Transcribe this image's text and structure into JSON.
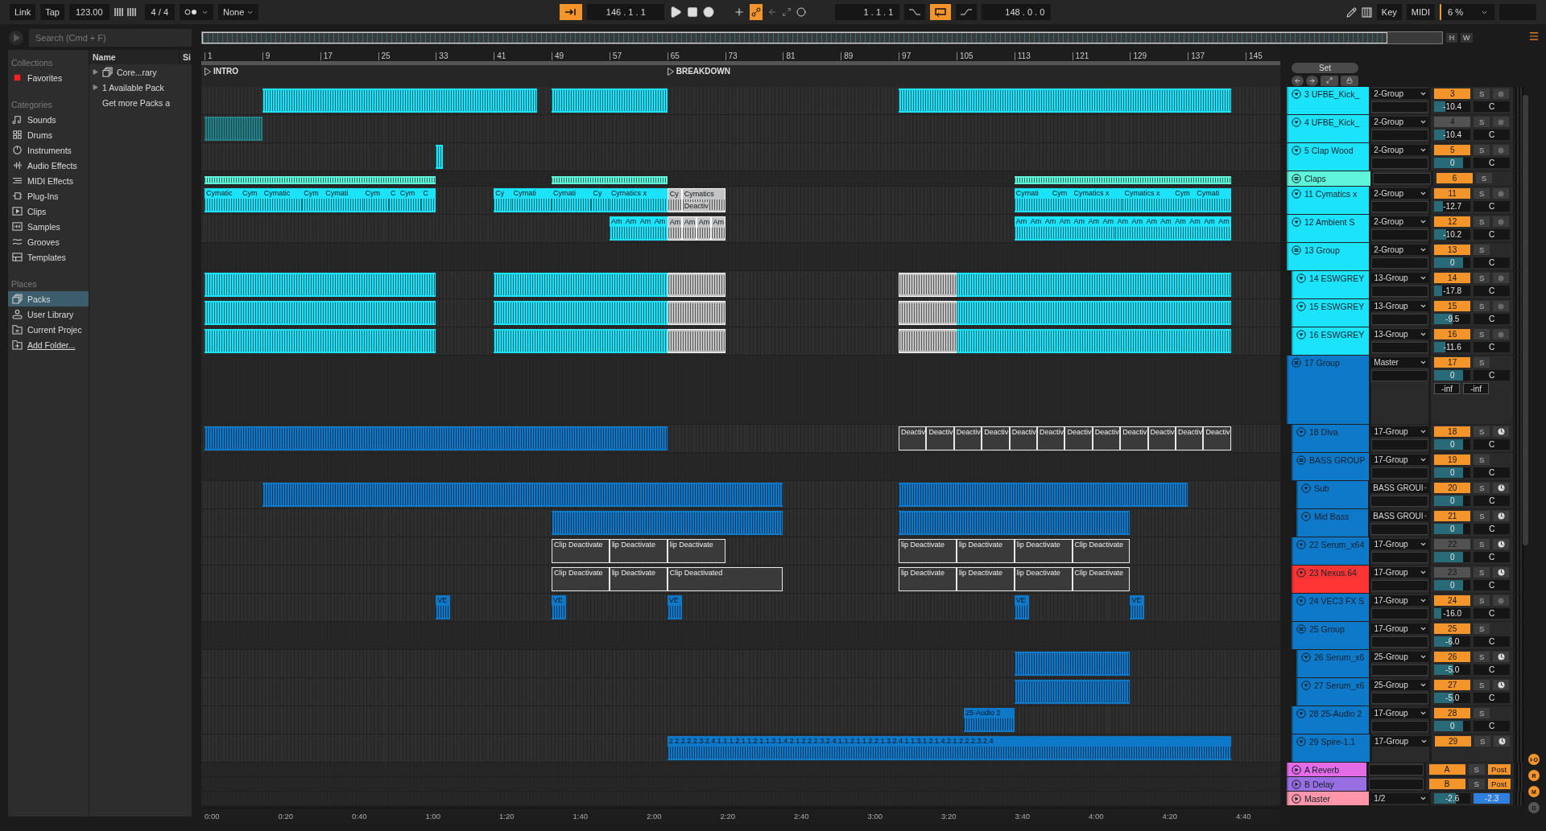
{
  "transport": {
    "link": "Link",
    "tap": "Tap",
    "tempo": "123.00",
    "signature": "4 / 4",
    "quantize": "None",
    "position": "146 .  1 .  1",
    "loop_start": "1 .  1 .  1",
    "loop_length": "148 .  0 .  0",
    "key": "Key",
    "midi": "MIDI",
    "cpu": "6 %",
    "follow": true,
    "loop": true
  },
  "browser": {
    "search": {
      "placeholder": "Search (Cmd + F)"
    },
    "sections": [
      {
        "title": "Collections",
        "items": [
          {
            "label": "Favorites",
            "color": "#ff2020",
            "selected": false
          }
        ]
      },
      {
        "title": "Categories",
        "items": [
          {
            "label": "Sounds",
            "selected": false
          },
          {
            "label": "Drums",
            "selected": false
          },
          {
            "label": "Instruments",
            "selected": false
          },
          {
            "label": "Audio Effects",
            "selected": false
          },
          {
            "label": "MIDI Effects",
            "selected": false
          },
          {
            "label": "Plug-Ins",
            "selected": false
          },
          {
            "label": "Clips",
            "selected": false
          },
          {
            "label": "Samples",
            "selected": false
          },
          {
            "label": "Grooves",
            "selected": false
          },
          {
            "label": "Templates",
            "selected": false
          }
        ]
      },
      {
        "title": "Places",
        "items": [
          {
            "label": "Packs",
            "selected": true
          },
          {
            "label": "User Library",
            "selected": false
          },
          {
            "label": "Current Projec",
            "selected": false
          },
          {
            "label": "Add Folder...",
            "selected": false
          }
        ]
      }
    ],
    "columns": [
      "Name",
      "Si"
    ],
    "files": [
      {
        "label": "Core...rary",
        "kind": "pack"
      },
      {
        "label": "1 Available Pack",
        "kind": "folder"
      },
      {
        "label": "Get more Packs a",
        "kind": "link"
      }
    ]
  },
  "set_button": "Set",
  "overview_buttons": [
    "H",
    "W"
  ],
  "ruler": [
    "1",
    "9",
    "17",
    "25",
    "33",
    "41",
    "49",
    "57",
    "65",
    "73",
    "81",
    "89",
    "97",
    "105",
    "113",
    "121",
    "129",
    "137",
    "145"
  ],
  "locators": [
    "INTRO",
    "BREAKDOWN"
  ],
  "tracks": [
    {
      "name": "3 UFBE_Kick_",
      "kind": "audio",
      "color": "#1be3fb",
      "output": "2-Group",
      "number": "3",
      "active": true,
      "volume": "-10.4",
      "level": 0.3,
      "pan": "C",
      "solo": "S",
      "clips": [
        {
          "selected": false,
          "deactivated": false
        },
        {
          "selected": false,
          "deactivated": false
        },
        {
          "selected": false,
          "deactivated": false
        }
      ]
    },
    {
      "name": "4 UFBE_Kick_",
      "kind": "audio",
      "color": "#1be3fb",
      "output": "2-Group",
      "number": "4",
      "active": false,
      "volume": "-10.4",
      "level": 0.3,
      "pan": "C",
      "solo": "S",
      "clips": [
        {
          "selected": false,
          "deactivated": false
        }
      ]
    },
    {
      "name": "5 Clap Wood",
      "kind": "audio",
      "color": "#1be3fb",
      "output": "2-Group",
      "number": "5",
      "active": true,
      "volume": "0",
      "level": 0.8,
      "pan": "C",
      "solo": "S",
      "clips": [
        {
          "selected": false,
          "deactivated": false
        }
      ]
    },
    {
      "name": "Claps",
      "kind": "group",
      "color": "#5ef5da",
      "number": "6",
      "active": true,
      "solo": "S",
      "clips": [
        {
          "selected": false,
          "deactivated": false
        },
        {
          "selected": false,
          "deactivated": false
        },
        {
          "selected": false,
          "deactivated": false
        }
      ]
    },
    {
      "name": "11 Cymatics x",
      "kind": "audio",
      "color": "#1be3fb",
      "output": "2-Group",
      "number": "11",
      "active": true,
      "volume": "-12.7",
      "level": 0.25,
      "pan": "C",
      "solo": "S",
      "clips": [
        {
          "label": "Cymatic",
          "selected": false,
          "deactivated": false
        },
        {
          "label": "Cym",
          "selected": false,
          "deactivated": false
        },
        {
          "label": "Cymatic",
          "selected": false,
          "deactivated": false
        },
        {
          "label": "Cym",
          "selected": false,
          "deactivated": false
        },
        {
          "label": "Cymati",
          "selected": false,
          "deactivated": false
        },
        {
          "label": "Cym",
          "selected": false,
          "deactivated": false
        },
        {
          "label": "C",
          "selected": false,
          "deactivated": false
        },
        {
          "label": "Cym",
          "selected": false,
          "deactivated": false
        },
        {
          "label": "C",
          "selected": false,
          "deactivated": false
        },
        {
          "label": "Cy",
          "selected": false,
          "deactivated": false
        },
        {
          "label": "Cymati",
          "selected": false,
          "deactivated": false
        },
        {
          "label": "Cymati",
          "selected": false,
          "deactivated": false
        },
        {
          "label": "Cy",
          "selected": false,
          "deactivated": false
        },
        {
          "label": "Cymatics x",
          "selected": false,
          "deactivated": false
        },
        {
          "label": "Cy",
          "selected": true,
          "deactivated": false
        },
        {
          "label": "Cymatics",
          "sublabel": "Deactiv",
          "selected": true,
          "deactivated": false
        },
        {
          "label": "Cymati",
          "selected": false,
          "deactivated": false
        },
        {
          "label": "Cym",
          "selected": false,
          "deactivated": false
        },
        {
          "label": "Cymatics x",
          "selected": false,
          "deactivated": false
        },
        {
          "label": "Cymatics x",
          "selected": false,
          "deactivated": false
        },
        {
          "label": "Cym",
          "selected": false,
          "deactivated": false
        },
        {
          "label": "Cymati",
          "selected": false,
          "deactivated": false
        }
      ]
    },
    {
      "name": "12 Ambient S",
      "kind": "audio",
      "color": "#1be3fb",
      "output": "2-Group",
      "number": "12",
      "active": true,
      "volume": "-10.2",
      "level": 0.32,
      "pan": "C",
      "solo": "S",
      "clips": [
        {
          "label": "Am",
          "selected": false,
          "deactivated": false
        },
        {
          "label": "Am",
          "selected": false,
          "deactivated": false
        },
        {
          "label": "Am",
          "selected": false,
          "deactivated": false
        },
        {
          "label": "Am",
          "selected": false,
          "deactivated": false
        },
        {
          "label": "Am",
          "selected": true,
          "deactivated": false
        },
        {
          "label": "Am",
          "selected": true,
          "deactivated": false
        },
        {
          "label": "Am",
          "selected": true,
          "deactivated": false
        },
        {
          "label": "Am",
          "selected": true,
          "deactivated": false
        },
        {
          "label": "Am",
          "selected": false,
          "deactivated": false
        },
        {
          "label": "Am",
          "selected": false,
          "deactivated": false
        },
        {
          "label": "Am",
          "selected": false,
          "deactivated": false
        },
        {
          "label": "Am",
          "selected": false,
          "deactivated": false
        },
        {
          "label": "Am",
          "selected": false,
          "deactivated": false
        },
        {
          "label": "Am",
          "selected": false,
          "deactivated": false
        },
        {
          "label": "Am",
          "selected": false,
          "deactivated": false
        },
        {
          "label": "Am",
          "selected": false,
          "deactivated": false
        },
        {
          "label": "Am",
          "selected": false,
          "deactivated": false
        },
        {
          "label": "Am",
          "selected": false,
          "deactivated": false
        },
        {
          "label": "Am",
          "selected": false,
          "deactivated": false
        },
        {
          "label": "Am",
          "selected": false,
          "deactivated": false
        },
        {
          "label": "Am",
          "selected": false,
          "deactivated": false
        },
        {
          "label": "Am",
          "selected": false,
          "deactivated": false
        },
        {
          "label": "Am",
          "selected": false,
          "deactivated": false
        }
      ]
    },
    {
      "name": "13 Group",
      "kind": "group",
      "color": "#1be3fb",
      "output": "2-Group",
      "number": "13",
      "active": true,
      "volume": "0",
      "level": 0.8,
      "pan": "C",
      "solo": "S",
      "children": [
        {
          "name": "14 ESWGREY",
          "kind": "audio",
          "color": "#1be3fb",
          "output": "13-Group",
          "number": "14",
          "active": true,
          "volume": "-17.8",
          "level": 0.22,
          "pan": "C",
          "solo": "S",
          "clips": [
            {
              "selected": false,
              "deactivated": false
            },
            {
              "selected": false,
              "deactivated": false
            },
            {
              "selected": true,
              "deactivated": false
            },
            {
              "selected": true,
              "deactivated": false
            },
            {
              "selected": false,
              "deactivated": false
            }
          ]
        },
        {
          "name": "15 ESWGREY",
          "kind": "audio",
          "color": "#1be3fb",
          "output": "13-Group",
          "number": "15",
          "active": true,
          "volume": "-9.5",
          "level": 0.5,
          "pan": "C",
          "solo": "S",
          "clips": [
            {
              "selected": false,
              "deactivated": false
            },
            {
              "selected": false,
              "deactivated": false
            },
            {
              "selected": true,
              "deactivated": false
            },
            {
              "selected": true,
              "deactivated": false
            },
            {
              "selected": false,
              "deactivated": false
            }
          ]
        },
        {
          "name": "16 ESWGREY",
          "kind": "audio",
          "color": "#1be3fb",
          "output": "13-Group",
          "number": "16",
          "active": true,
          "volume": "-11.6",
          "level": 0.3,
          "pan": "C",
          "solo": "S",
          "clips": [
            {
              "selected": false,
              "deactivated": false
            },
            {
              "selected": false,
              "deactivated": false
            },
            {
              "selected": true,
              "deactivated": false
            },
            {
              "selected": true,
              "deactivated": false
            },
            {
              "selected": false,
              "deactivated": false
            }
          ]
        }
      ]
    },
    {
      "name": "17 Group",
      "kind": "group",
      "color": "#0e78c9",
      "output": "Master",
      "number": "17",
      "active": true,
      "volume": "0",
      "level": 0.8,
      "pan": "C",
      "solo": "S",
      "peaks": [
        "-inf",
        "-inf"
      ],
      "children": [
        {
          "name": "18 Diva",
          "kind": "midi",
          "color": "#0e78c9",
          "output": "17-Group",
          "number": "18",
          "active": true,
          "volume": "0",
          "level": 0.8,
          "pan": "C",
          "solo": "S",
          "clips": [
            {
              "selected": false,
              "deactivated": false
            },
            {
              "label": "Deactiv",
              "selected": false,
              "deactivated": true
            },
            {
              "label": "Deactiv",
              "selected": false,
              "deactivated": true
            },
            {
              "label": "Deactiv",
              "selected": false,
              "deactivated": true
            },
            {
              "label": "Deactiv",
              "selected": false,
              "deactivated": true
            },
            {
              "label": "Deactiv",
              "selected": false,
              "deactivated": true
            },
            {
              "label": "Deactiv",
              "selected": false,
              "deactivated": true
            },
            {
              "label": "Deactiv",
              "selected": false,
              "deactivated": true
            },
            {
              "label": "Deactiv",
              "selected": false,
              "deactivated": true
            },
            {
              "label": "Deactiv",
              "selected": false,
              "deactivated": true
            },
            {
              "label": "Deactiv",
              "selected": false,
              "deactivated": true
            },
            {
              "label": "Deactiv",
              "selected": false,
              "deactivated": true
            },
            {
              "label": "Deactiv",
              "selected": false,
              "deactivated": true
            }
          ]
        },
        {
          "name": "BASS GROUP",
          "kind": "group",
          "color": "#0e78c9",
          "output": "17-Group",
          "number": "19",
          "active": true,
          "volume": "0",
          "level": 0.8,
          "pan": "C",
          "solo": "S",
          "children": [
            {
              "name": "Sub",
              "kind": "midi",
              "color": "#0e78c9",
              "output": "BASS GROUI",
              "number": "20",
              "active": true,
              "volume": "0",
              "level": 0.8,
              "pan": "C",
              "solo": "S",
              "clips": [
                {
                  "selected": false,
                  "deactivated": false
                },
                {
                  "selected": false,
                  "deactivated": false
                }
              ]
            },
            {
              "name": "Mid Bass",
              "kind": "midi",
              "color": "#0e78c9",
              "output": "BASS GROUI",
              "number": "21",
              "active": true,
              "volume": "0",
              "level": 0.8,
              "pan": "C",
              "solo": "S",
              "clips": [
                {
                  "selected": false,
                  "deactivated": false
                },
                {
                  "selected": false,
                  "deactivated": false
                }
              ]
            }
          ]
        },
        {
          "name": "22 Serum_x64",
          "kind": "midi",
          "color": "#0e78c9",
          "output": "17-Group",
          "number": "22",
          "active": false,
          "volume": "0",
          "level": 0.8,
          "pan": "C",
          "solo": "S",
          "clips": [
            {
              "label": "Clip Deactivate",
              "selected": false,
              "deactivated": true
            },
            {
              "label": "lip Deactivate",
              "selected": false,
              "deactivated": true
            },
            {
              "label": "lip Deactivate",
              "selected": false,
              "deactivated": true
            },
            {
              "label": "lip Deactivate",
              "selected": false,
              "deactivated": true
            },
            {
              "label": "lip Deactivate",
              "selected": false,
              "deactivated": true
            },
            {
              "label": "lip Deactivate",
              "selected": false,
              "deactivated": true
            },
            {
              "label": "Clip Deactivate",
              "selected": false,
              "deactivated": true
            }
          ]
        },
        {
          "name": "23 Nexus.64",
          "kind": "midi",
          "color": "#ff3535",
          "output": "17-Group",
          "number": "23",
          "active": false,
          "volume": "0",
          "level": 0.8,
          "pan": "C",
          "solo": "S",
          "clips": [
            {
              "label": "Clip Deactivate",
              "selected": false,
              "deactivated": true
            },
            {
              "label": "lip Deactivate",
              "selected": false,
              "deactivated": true
            },
            {
              "label": "Clip Deactivated",
              "selected": false,
              "deactivated": true
            },
            {
              "label": "lip Deactivate",
              "selected": false,
              "deactivated": true
            },
            {
              "label": "lip Deactivate",
              "selected": false,
              "deactivated": true
            },
            {
              "label": "lip Deactivate",
              "selected": false,
              "deactivated": true
            },
            {
              "label": "Clip Deactivate",
              "selected": false,
              "deactivated": true
            }
          ]
        },
        {
          "name": "24 VEC3 FX S",
          "kind": "audio",
          "color": "#0e78c9",
          "output": "17-Group",
          "number": "24",
          "active": true,
          "volume": "-16.0",
          "level": 0.2,
          "pan": "C",
          "solo": "S",
          "clips": [
            {
              "label": "VE",
              "selected": false,
              "deactivated": false
            },
            {
              "label": "VE",
              "selected": false,
              "deactivated": false
            },
            {
              "label": "VE",
              "selected": false,
              "deactivated": false
            },
            {
              "label": "VE",
              "selected": false,
              "deactivated": false
            },
            {
              "label": "VE",
              "selected": false,
              "deactivated": false
            }
          ]
        },
        {
          "name": "25 Group",
          "kind": "group",
          "color": "#0e78c9",
          "output": "17-Group",
          "number": "25",
          "active": true,
          "volume": "-6.0",
          "level": 0.48,
          "pan": "C",
          "solo": "S",
          "children": [
            {
              "name": "26 Serum_x6",
              "kind": "midi",
              "color": "#0e78c9",
              "output": "25-Group",
              "number": "26",
              "active": true,
              "volume": "-5.0",
              "level": 0.52,
              "pan": "C",
              "solo": "S",
              "clips": [
                {
                  "selected": false,
                  "deactivated": false
                }
              ]
            },
            {
              "name": "27 Serum_x6",
              "kind": "midi",
              "color": "#0e78c9",
              "output": "25-Group",
              "number": "27",
              "active": true,
              "volume": "-5.0",
              "level": 0.52,
              "pan": "C",
              "solo": "S",
              "clips": [
                {
                  "selected": false,
                  "deactivated": false
                }
              ]
            }
          ]
        },
        {
          "name": "28 25-Audio 2",
          "kind": "bus",
          "color": "#0e78c9",
          "output": "17-Group",
          "number": "28",
          "active": true,
          "volume": "0",
          "level": 0.8,
          "pan": "C",
          "solo": "S",
          "clips": [
            {
              "label": "25-Audio 2",
              "selected": false,
              "deactivated": false
            }
          ]
        },
        {
          "name": "29 Spire-1.1",
          "kind": "midi",
          "color": "#0e78c9",
          "output": "17-Group",
          "number": "29",
          "active": true,
          "solo": "S",
          "clips": [
            {
              "label": "2.2.2.2.2.3.2.4.1.1.1.2.1.1.2.1.1.3.1.4.2.1.2.2.2.3.2.4.1.1.2.1.1.2.2.1.3.2.4.1.1.3.1.2.1.4.2.1.2.2.2.3.2.4",
              "selected": false,
              "deactivated": false
            }
          ]
        }
      ]
    }
  ],
  "returns": [
    {
      "name": "A Reverb",
      "color": "#e46be8",
      "number": "A",
      "solo": "S",
      "post": "Post"
    },
    {
      "name": "B Delay",
      "color": "#9a6ee3",
      "number": "B",
      "solo": "S",
      "post": "Post"
    }
  ],
  "master": {
    "name": "Master",
    "color": "#ff96aa",
    "output": "1/2",
    "volume": "-2.6",
    "level": 0.6,
    "cue_volume": "-2.3"
  },
  "side_buttons": [
    "I·O",
    "R",
    "M",
    "D"
  ],
  "time_ruler": [
    "0:00",
    "0:20",
    "0:40",
    "1:00",
    "1:20",
    "1:40",
    "2:00",
    "2:20",
    "2:40",
    "3:00",
    "3:20",
    "3:40",
    "4:00",
    "4:20",
    "4:40"
  ]
}
